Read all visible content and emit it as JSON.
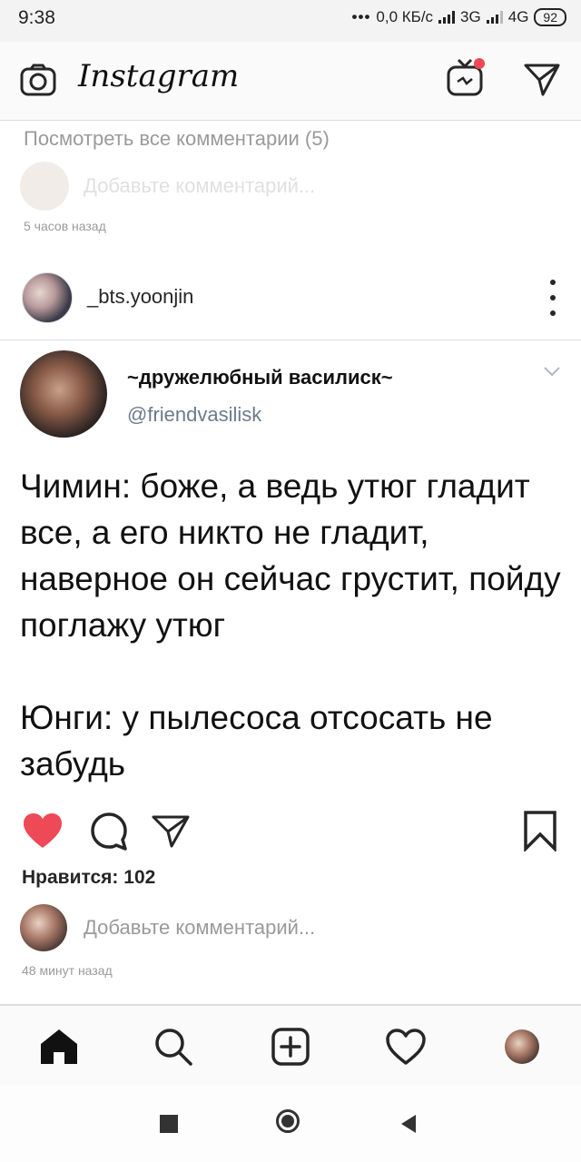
{
  "status_bar": {
    "time": "9:38",
    "network": "0,0 КБ/с",
    "net1": "3G",
    "net2": "4G",
    "battery": "92"
  },
  "app": {
    "title": "Instagram"
  },
  "previous_post": {
    "view_all": "Посмотреть все комментарии (5)",
    "add_comment": "Добавьте комментарий...",
    "time": "5 часов назад"
  },
  "post": {
    "username": "_bts.yoonjin",
    "tweet": {
      "name": "~дружелюбный василиск~",
      "handle": "@friendvasilisk",
      "text": "Чимин: боже, а ведь утюг гладит все, а его никто не гладит, наверное он сейчас грустит, пойду поглажу утюг\n\nЮнги: у пылесоса отсосать не забудь"
    },
    "likes": "Нравится: 102",
    "add_comment_placeholder": "Добавьте комментарий...",
    "time": "48 минут назад",
    "liked": true,
    "like_color": "#ed4956"
  },
  "icons": {
    "camera": "camera-icon",
    "igtv": "igtv-icon",
    "direct": "direct-send-icon",
    "heart": "heart-icon",
    "comment": "comment-icon",
    "share": "share-icon",
    "bookmark": "bookmark-icon",
    "home": "home-icon",
    "search": "search-icon",
    "add": "add-post-icon",
    "activity": "activity-heart-icon"
  }
}
